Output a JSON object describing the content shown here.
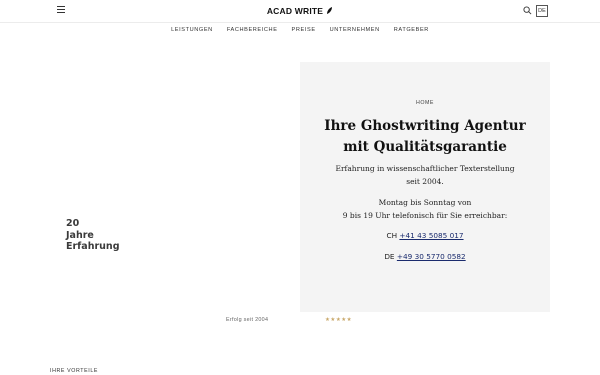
{
  "header": {
    "logo": "ACAD WRITE",
    "lang": "DE",
    "icons": {
      "menu": "menu-icon",
      "search": "search-icon",
      "logo_mark": "feather-icon"
    }
  },
  "nav": {
    "items": [
      "LEISTUNGEN",
      "FACHBEREICHE",
      "PREISE",
      "UNTERNEHMEN",
      "RATGEBER"
    ]
  },
  "hero": {
    "left": {
      "line1": "20",
      "line2": "Jahre",
      "line3": "Erfahrung"
    },
    "breadcrumb": "HOME",
    "title_line1": "Ihre Ghostwriting Agentur",
    "title_line2": "mit Qualitätsgarantie",
    "intro_line1": "Erfahrung in wissenschaftlicher Texterstellung",
    "intro_line2": "seit 2004.",
    "hours_line1": "Montag bis Sonntag von",
    "hours_line2": "9 bis 19 Uhr telefonisch für Sie erreichbar:",
    "contacts": [
      {
        "country": "CH",
        "phone": "+41 43 5085 017"
      },
      {
        "country": "DE",
        "phone": "+49 30 5770 0582"
      }
    ]
  },
  "footer_strip": {
    "since": "Erfolg seit 2004",
    "stars": "★★★★★"
  },
  "section": {
    "label": "IHRE VORTEILE"
  },
  "colors": {
    "card_bg": "#f4f4f4",
    "link": "#1a2b6d",
    "stars": "#c9a86a"
  }
}
